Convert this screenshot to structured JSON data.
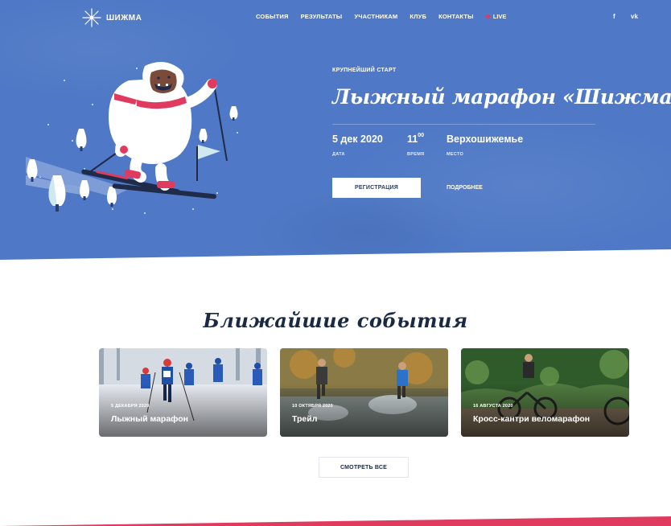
{
  "brand": {
    "name": "ШИЖМА"
  },
  "nav": {
    "items": [
      "СОБЫТИЯ",
      "РЕЗУЛЬТАТЫ",
      "УЧАСТНИКАМ",
      "КЛУБ",
      "КОНТАКТЫ"
    ],
    "live": "LIVE",
    "social": {
      "facebook": "f",
      "vk": "vk"
    }
  },
  "hero": {
    "kicker": "КРУПНЕЙШИЙ СТАРТ",
    "title": "Лыжный марафон «Шижма»",
    "date": {
      "value": "5 дек 2020",
      "label": "ДАТА"
    },
    "time": {
      "hours": "11",
      "minutes": "00",
      "label": "ВРЕМЯ"
    },
    "place": {
      "value": "Верхошижемье",
      "label": "МЕСТО"
    },
    "register_label": "РЕГИСТРАЦИЯ",
    "more_label": "ПОДРОБНЕЕ"
  },
  "events": {
    "title": "Ближайшие события",
    "cards": [
      {
        "date": "5 ДЕКАБРЯ 2020",
        "title": "Лыжный марафон"
      },
      {
        "date": "10 ОКТЯБРЯ 2020",
        "title": "Трейл"
      },
      {
        "date": "16 АВГУСТА 2020",
        "title": "Кросс-кантри веломарафон"
      }
    ],
    "view_all_label": "СМОТРЕТЬ ВСЕ"
  },
  "colors": {
    "hero_bg": "#4f79c6",
    "accent": "#e03b5e",
    "dark_text": "#1b2a44"
  },
  "icons": [
    "snowflake-logo-icon",
    "live-dot-icon",
    "facebook-icon",
    "vk-icon",
    "yeti-skier-illustration"
  ]
}
